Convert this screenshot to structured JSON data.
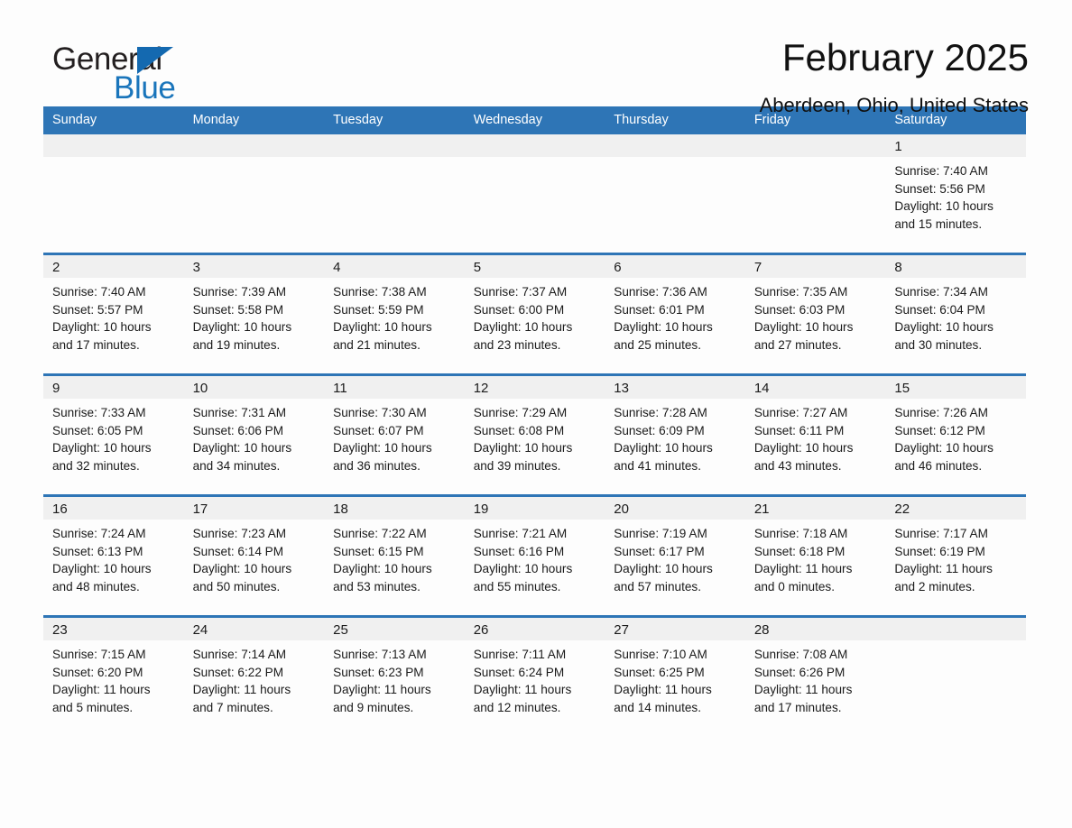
{
  "brand": {
    "name_part1": "General",
    "name_part2": "Blue",
    "logo_icon": "triangle-flag-icon",
    "accent_color": "#1a75bb"
  },
  "header": {
    "title": "February 2025",
    "location": "Aberdeen, Ohio, United States"
  },
  "theme": {
    "header_blue": "#2e75b6",
    "daynum_gray": "#f0f0f0",
    "page_bg": "#fdfdfd"
  },
  "weekdays": [
    "Sunday",
    "Monday",
    "Tuesday",
    "Wednesday",
    "Thursday",
    "Friday",
    "Saturday"
  ],
  "weeks": [
    [
      {
        "day": "",
        "empty": true
      },
      {
        "day": "",
        "empty": true
      },
      {
        "day": "",
        "empty": true
      },
      {
        "day": "",
        "empty": true
      },
      {
        "day": "",
        "empty": true
      },
      {
        "day": "",
        "empty": true
      },
      {
        "day": "1",
        "sunrise": "Sunrise: 7:40 AM",
        "sunset": "Sunset: 5:56 PM",
        "daylight1": "Daylight: 10 hours",
        "daylight2": "and 15 minutes."
      }
    ],
    [
      {
        "day": "2",
        "sunrise": "Sunrise: 7:40 AM",
        "sunset": "Sunset: 5:57 PM",
        "daylight1": "Daylight: 10 hours",
        "daylight2": "and 17 minutes."
      },
      {
        "day": "3",
        "sunrise": "Sunrise: 7:39 AM",
        "sunset": "Sunset: 5:58 PM",
        "daylight1": "Daylight: 10 hours",
        "daylight2": "and 19 minutes."
      },
      {
        "day": "4",
        "sunrise": "Sunrise: 7:38 AM",
        "sunset": "Sunset: 5:59 PM",
        "daylight1": "Daylight: 10 hours",
        "daylight2": "and 21 minutes."
      },
      {
        "day": "5",
        "sunrise": "Sunrise: 7:37 AM",
        "sunset": "Sunset: 6:00 PM",
        "daylight1": "Daylight: 10 hours",
        "daylight2": "and 23 minutes."
      },
      {
        "day": "6",
        "sunrise": "Sunrise: 7:36 AM",
        "sunset": "Sunset: 6:01 PM",
        "daylight1": "Daylight: 10 hours",
        "daylight2": "and 25 minutes."
      },
      {
        "day": "7",
        "sunrise": "Sunrise: 7:35 AM",
        "sunset": "Sunset: 6:03 PM",
        "daylight1": "Daylight: 10 hours",
        "daylight2": "and 27 minutes."
      },
      {
        "day": "8",
        "sunrise": "Sunrise: 7:34 AM",
        "sunset": "Sunset: 6:04 PM",
        "daylight1": "Daylight: 10 hours",
        "daylight2": "and 30 minutes."
      }
    ],
    [
      {
        "day": "9",
        "sunrise": "Sunrise: 7:33 AM",
        "sunset": "Sunset: 6:05 PM",
        "daylight1": "Daylight: 10 hours",
        "daylight2": "and 32 minutes."
      },
      {
        "day": "10",
        "sunrise": "Sunrise: 7:31 AM",
        "sunset": "Sunset: 6:06 PM",
        "daylight1": "Daylight: 10 hours",
        "daylight2": "and 34 minutes."
      },
      {
        "day": "11",
        "sunrise": "Sunrise: 7:30 AM",
        "sunset": "Sunset: 6:07 PM",
        "daylight1": "Daylight: 10 hours",
        "daylight2": "and 36 minutes."
      },
      {
        "day": "12",
        "sunrise": "Sunrise: 7:29 AM",
        "sunset": "Sunset: 6:08 PM",
        "daylight1": "Daylight: 10 hours",
        "daylight2": "and 39 minutes."
      },
      {
        "day": "13",
        "sunrise": "Sunrise: 7:28 AM",
        "sunset": "Sunset: 6:09 PM",
        "daylight1": "Daylight: 10 hours",
        "daylight2": "and 41 minutes."
      },
      {
        "day": "14",
        "sunrise": "Sunrise: 7:27 AM",
        "sunset": "Sunset: 6:11 PM",
        "daylight1": "Daylight: 10 hours",
        "daylight2": "and 43 minutes."
      },
      {
        "day": "15",
        "sunrise": "Sunrise: 7:26 AM",
        "sunset": "Sunset: 6:12 PM",
        "daylight1": "Daylight: 10 hours",
        "daylight2": "and 46 minutes."
      }
    ],
    [
      {
        "day": "16",
        "sunrise": "Sunrise: 7:24 AM",
        "sunset": "Sunset: 6:13 PM",
        "daylight1": "Daylight: 10 hours",
        "daylight2": "and 48 minutes."
      },
      {
        "day": "17",
        "sunrise": "Sunrise: 7:23 AM",
        "sunset": "Sunset: 6:14 PM",
        "daylight1": "Daylight: 10 hours",
        "daylight2": "and 50 minutes."
      },
      {
        "day": "18",
        "sunrise": "Sunrise: 7:22 AM",
        "sunset": "Sunset: 6:15 PM",
        "daylight1": "Daylight: 10 hours",
        "daylight2": "and 53 minutes."
      },
      {
        "day": "19",
        "sunrise": "Sunrise: 7:21 AM",
        "sunset": "Sunset: 6:16 PM",
        "daylight1": "Daylight: 10 hours",
        "daylight2": "and 55 minutes."
      },
      {
        "day": "20",
        "sunrise": "Sunrise: 7:19 AM",
        "sunset": "Sunset: 6:17 PM",
        "daylight1": "Daylight: 10 hours",
        "daylight2": "and 57 minutes."
      },
      {
        "day": "21",
        "sunrise": "Sunrise: 7:18 AM",
        "sunset": "Sunset: 6:18 PM",
        "daylight1": "Daylight: 11 hours",
        "daylight2": "and 0 minutes."
      },
      {
        "day": "22",
        "sunrise": "Sunrise: 7:17 AM",
        "sunset": "Sunset: 6:19 PM",
        "daylight1": "Daylight: 11 hours",
        "daylight2": "and 2 minutes."
      }
    ],
    [
      {
        "day": "23",
        "sunrise": "Sunrise: 7:15 AM",
        "sunset": "Sunset: 6:20 PM",
        "daylight1": "Daylight: 11 hours",
        "daylight2": "and 5 minutes."
      },
      {
        "day": "24",
        "sunrise": "Sunrise: 7:14 AM",
        "sunset": "Sunset: 6:22 PM",
        "daylight1": "Daylight: 11 hours",
        "daylight2": "and 7 minutes."
      },
      {
        "day": "25",
        "sunrise": "Sunrise: 7:13 AM",
        "sunset": "Sunset: 6:23 PM",
        "daylight1": "Daylight: 11 hours",
        "daylight2": "and 9 minutes."
      },
      {
        "day": "26",
        "sunrise": "Sunrise: 7:11 AM",
        "sunset": "Sunset: 6:24 PM",
        "daylight1": "Daylight: 11 hours",
        "daylight2": "and 12 minutes."
      },
      {
        "day": "27",
        "sunrise": "Sunrise: 7:10 AM",
        "sunset": "Sunset: 6:25 PM",
        "daylight1": "Daylight: 11 hours",
        "daylight2": "and 14 minutes."
      },
      {
        "day": "28",
        "sunrise": "Sunrise: 7:08 AM",
        "sunset": "Sunset: 6:26 PM",
        "daylight1": "Daylight: 11 hours",
        "daylight2": "and 17 minutes."
      },
      {
        "day": "",
        "empty": true
      }
    ]
  ]
}
